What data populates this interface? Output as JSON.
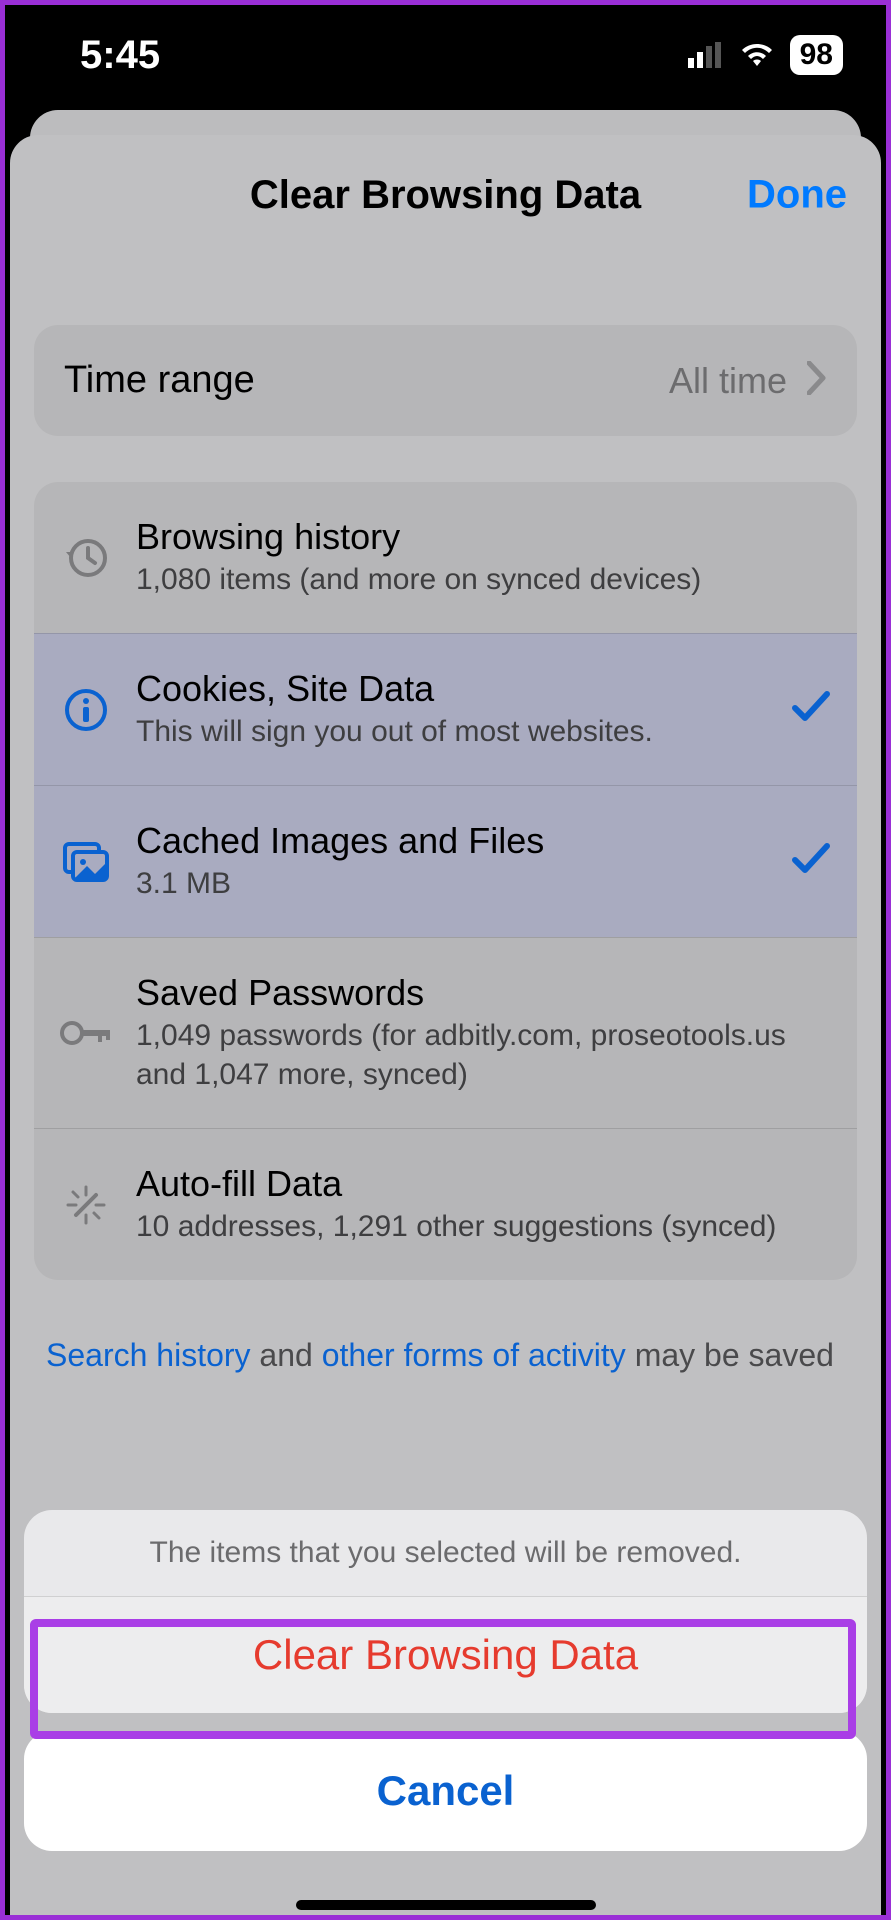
{
  "status": {
    "time": "5:45",
    "battery": "98"
  },
  "header": {
    "title": "Clear Browsing Data",
    "done": "Done"
  },
  "time_range": {
    "label": "Time range",
    "value": "All time"
  },
  "items": [
    {
      "title": "Browsing history",
      "sub": "1,080 items (and more on synced devices)",
      "icon": "history",
      "selected": false
    },
    {
      "title": "Cookies, Site Data",
      "sub": "This will sign you out of most websites.",
      "icon": "info",
      "selected": true
    },
    {
      "title": "Cached Images and Files",
      "sub": "3.1 MB",
      "icon": "images",
      "selected": true
    },
    {
      "title": "Saved Passwords",
      "sub": "1,049 passwords (for adbitly.com, proseotools.us and 1,047 more, synced)",
      "icon": "key",
      "selected": false
    },
    {
      "title": "Auto-fill Data",
      "sub": "10 addresses, 1,291 other suggestions (synced)",
      "icon": "wand",
      "selected": false
    }
  ],
  "footer": {
    "link1": "Search history",
    "mid": " and ",
    "link2": "other forms of activity",
    "rest": " may be saved"
  },
  "action_sheet": {
    "message": "The items that you selected will be removed.",
    "primary": "Clear Browsing Data",
    "cancel": "Cancel"
  }
}
